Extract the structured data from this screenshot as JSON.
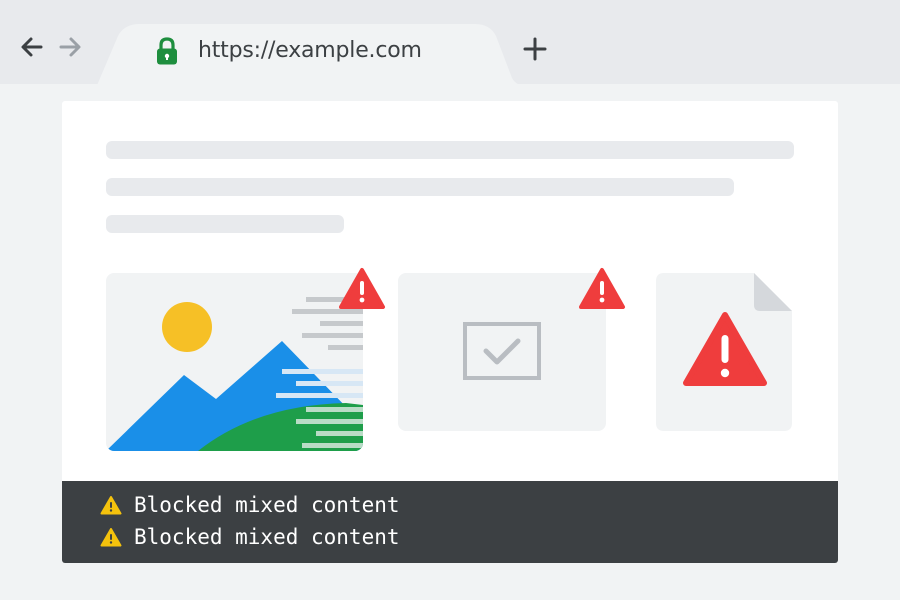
{
  "browser": {
    "url": "https://example.com",
    "back_icon": "arrow-left-icon",
    "forward_icon": "arrow-right-icon",
    "security_icon": "lock-icon",
    "new_tab_icon": "plus-icon"
  },
  "colors": {
    "warning_red": "#ef3d3d",
    "warning_yellow": "#f4c20d",
    "lock_green": "#1e8e3e",
    "console_bg": "#3c4043"
  },
  "content": {
    "blocked_image_icon": "blocked-image-icon",
    "blocked_checkbox_icon": "checkbox-icon",
    "blocked_file_icon": "file-warning-icon"
  },
  "console": {
    "messages": [
      {
        "icon": "warning-icon",
        "text": "Blocked mixed content"
      },
      {
        "icon": "warning-icon",
        "text": "Blocked mixed content"
      }
    ]
  }
}
